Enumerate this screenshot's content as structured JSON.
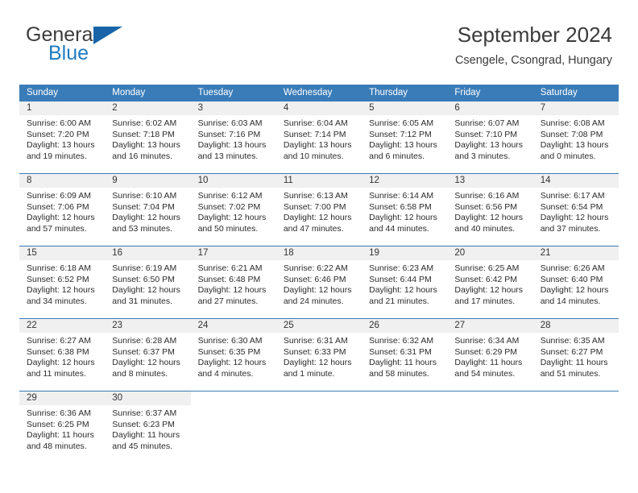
{
  "brand": {
    "name_top": "General",
    "name_bottom": "Blue",
    "triangle_icon": "blue-triangle-logo-mark",
    "color_top": "#3c3c3c",
    "color_bottom": "#1f7bc1",
    "triangle_color": "#1765a8"
  },
  "header": {
    "title": "September 2024",
    "subtitle": "Csengele, Csongrad, Hungary"
  },
  "theme": {
    "header_blue": "#3a7cb8",
    "day_band_gray": "#f0f0f0",
    "text": "#2b2b2b"
  },
  "weekdays": [
    "Sunday",
    "Monday",
    "Tuesday",
    "Wednesday",
    "Thursday",
    "Friday",
    "Saturday"
  ],
  "weeks": [
    [
      {
        "day": "1",
        "lines": [
          "Sunrise: 6:00 AM",
          "Sunset: 7:20 PM",
          "Daylight: 13 hours",
          "and 19 minutes."
        ]
      },
      {
        "day": "2",
        "lines": [
          "Sunrise: 6:02 AM",
          "Sunset: 7:18 PM",
          "Daylight: 13 hours",
          "and 16 minutes."
        ]
      },
      {
        "day": "3",
        "lines": [
          "Sunrise: 6:03 AM",
          "Sunset: 7:16 PM",
          "Daylight: 13 hours",
          "and 13 minutes."
        ]
      },
      {
        "day": "4",
        "lines": [
          "Sunrise: 6:04 AM",
          "Sunset: 7:14 PM",
          "Daylight: 13 hours",
          "and 10 minutes."
        ]
      },
      {
        "day": "5",
        "lines": [
          "Sunrise: 6:05 AM",
          "Sunset: 7:12 PM",
          "Daylight: 13 hours",
          "and 6 minutes."
        ]
      },
      {
        "day": "6",
        "lines": [
          "Sunrise: 6:07 AM",
          "Sunset: 7:10 PM",
          "Daylight: 13 hours",
          "and 3 minutes."
        ]
      },
      {
        "day": "7",
        "lines": [
          "Sunrise: 6:08 AM",
          "Sunset: 7:08 PM",
          "Daylight: 13 hours",
          "and 0 minutes."
        ]
      }
    ],
    [
      {
        "day": "8",
        "lines": [
          "Sunrise: 6:09 AM",
          "Sunset: 7:06 PM",
          "Daylight: 12 hours",
          "and 57 minutes."
        ]
      },
      {
        "day": "9",
        "lines": [
          "Sunrise: 6:10 AM",
          "Sunset: 7:04 PM",
          "Daylight: 12 hours",
          "and 53 minutes."
        ]
      },
      {
        "day": "10",
        "lines": [
          "Sunrise: 6:12 AM",
          "Sunset: 7:02 PM",
          "Daylight: 12 hours",
          "and 50 minutes."
        ]
      },
      {
        "day": "11",
        "lines": [
          "Sunrise: 6:13 AM",
          "Sunset: 7:00 PM",
          "Daylight: 12 hours",
          "and 47 minutes."
        ]
      },
      {
        "day": "12",
        "lines": [
          "Sunrise: 6:14 AM",
          "Sunset: 6:58 PM",
          "Daylight: 12 hours",
          "and 44 minutes."
        ]
      },
      {
        "day": "13",
        "lines": [
          "Sunrise: 6:16 AM",
          "Sunset: 6:56 PM",
          "Daylight: 12 hours",
          "and 40 minutes."
        ]
      },
      {
        "day": "14",
        "lines": [
          "Sunrise: 6:17 AM",
          "Sunset: 6:54 PM",
          "Daylight: 12 hours",
          "and 37 minutes."
        ]
      }
    ],
    [
      {
        "day": "15",
        "lines": [
          "Sunrise: 6:18 AM",
          "Sunset: 6:52 PM",
          "Daylight: 12 hours",
          "and 34 minutes."
        ]
      },
      {
        "day": "16",
        "lines": [
          "Sunrise: 6:19 AM",
          "Sunset: 6:50 PM",
          "Daylight: 12 hours",
          "and 31 minutes."
        ]
      },
      {
        "day": "17",
        "lines": [
          "Sunrise: 6:21 AM",
          "Sunset: 6:48 PM",
          "Daylight: 12 hours",
          "and 27 minutes."
        ]
      },
      {
        "day": "18",
        "lines": [
          "Sunrise: 6:22 AM",
          "Sunset: 6:46 PM",
          "Daylight: 12 hours",
          "and 24 minutes."
        ]
      },
      {
        "day": "19",
        "lines": [
          "Sunrise: 6:23 AM",
          "Sunset: 6:44 PM",
          "Daylight: 12 hours",
          "and 21 minutes."
        ]
      },
      {
        "day": "20",
        "lines": [
          "Sunrise: 6:25 AM",
          "Sunset: 6:42 PM",
          "Daylight: 12 hours",
          "and 17 minutes."
        ]
      },
      {
        "day": "21",
        "lines": [
          "Sunrise: 6:26 AM",
          "Sunset: 6:40 PM",
          "Daylight: 12 hours",
          "and 14 minutes."
        ]
      }
    ],
    [
      {
        "day": "22",
        "lines": [
          "Sunrise: 6:27 AM",
          "Sunset: 6:38 PM",
          "Daylight: 12 hours",
          "and 11 minutes."
        ]
      },
      {
        "day": "23",
        "lines": [
          "Sunrise: 6:28 AM",
          "Sunset: 6:37 PM",
          "Daylight: 12 hours",
          "and 8 minutes."
        ]
      },
      {
        "day": "24",
        "lines": [
          "Sunrise: 6:30 AM",
          "Sunset: 6:35 PM",
          "Daylight: 12 hours",
          "and 4 minutes."
        ]
      },
      {
        "day": "25",
        "lines": [
          "Sunrise: 6:31 AM",
          "Sunset: 6:33 PM",
          "Daylight: 12 hours",
          "and 1 minute."
        ]
      },
      {
        "day": "26",
        "lines": [
          "Sunrise: 6:32 AM",
          "Sunset: 6:31 PM",
          "Daylight: 11 hours",
          "and 58 minutes."
        ]
      },
      {
        "day": "27",
        "lines": [
          "Sunrise: 6:34 AM",
          "Sunset: 6:29 PM",
          "Daylight: 11 hours",
          "and 54 minutes."
        ]
      },
      {
        "day": "28",
        "lines": [
          "Sunrise: 6:35 AM",
          "Sunset: 6:27 PM",
          "Daylight: 11 hours",
          "and 51 minutes."
        ]
      }
    ],
    [
      {
        "day": "29",
        "lines": [
          "Sunrise: 6:36 AM",
          "Sunset: 6:25 PM",
          "Daylight: 11 hours",
          "and 48 minutes."
        ]
      },
      {
        "day": "30",
        "lines": [
          "Sunrise: 6:37 AM",
          "Sunset: 6:23 PM",
          "Daylight: 11 hours",
          "and 45 minutes."
        ]
      },
      {
        "day": "",
        "lines": []
      },
      {
        "day": "",
        "lines": []
      },
      {
        "day": "",
        "lines": []
      },
      {
        "day": "",
        "lines": []
      },
      {
        "day": "",
        "lines": []
      }
    ]
  ]
}
